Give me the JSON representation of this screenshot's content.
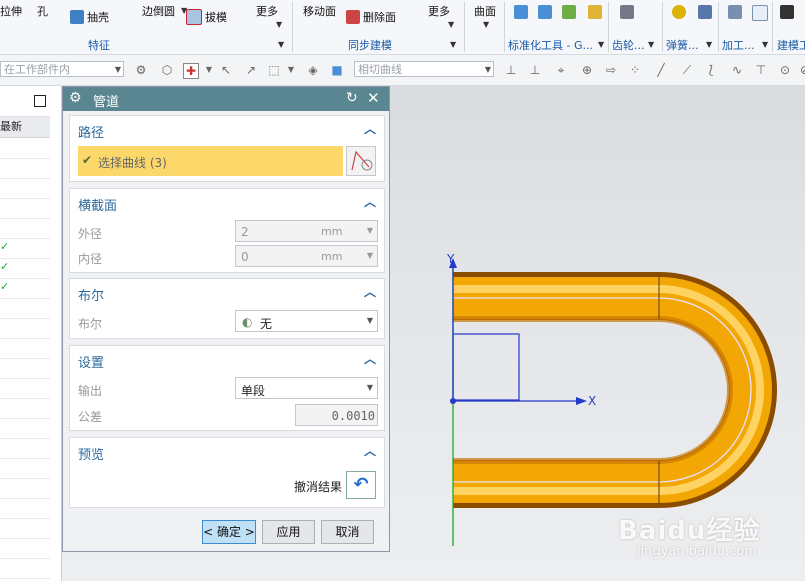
{
  "ribbon": {
    "partial_left_top": "拉伸",
    "hole": "孔",
    "shell": "抽壳",
    "edge_blend": "边倒圆",
    "draft": "拔模",
    "more1": "更多",
    "move_face": "移动面",
    "delete_face": "删除面",
    "more2": "更多",
    "surface": "曲面",
    "group_feature": "特征",
    "group_sync": "同步建模",
    "group_std_tools": "标准化工具 - G...",
    "group_gear": "齿轮...",
    "group_spring": "弹簧...",
    "group_machining": "加工...",
    "group_modeling": "建模工"
  },
  "toolbar2": {
    "scope_combo": "在工作部件内",
    "curve_rule_combo": "相切曲线"
  },
  "left_pane": {
    "partial_header": "最新"
  },
  "dialog": {
    "title": "管道",
    "path": {
      "title": "路径",
      "select_label": "选择曲线 (3)"
    },
    "cross_section": {
      "title": "横截面",
      "outer_label": "外径",
      "outer_value": "2",
      "outer_unit": "mm",
      "inner_label": "内径",
      "inner_value": "0",
      "inner_unit": "mm"
    },
    "boolean": {
      "title": "布尔",
      "label": "布尔",
      "value": "无"
    },
    "settings": {
      "title": "设置",
      "output_label": "输出",
      "output_value": "单段",
      "tolerance_label": "公差",
      "tolerance_value": "0.0010"
    },
    "preview": {
      "title": "预览",
      "undo_label": "撤消结果"
    },
    "buttons": {
      "ok": "< 确定 >",
      "apply": "应用",
      "cancel": "取消"
    }
  },
  "viewport": {
    "axis_y": "Y",
    "axis_x": "X",
    "watermark": "Baidu经验",
    "watermark_url": "jingyan.baidu.com"
  },
  "colors": {
    "pipe": "#f2a705",
    "accent": "#2d6a9c",
    "title_bar": "#5a8691",
    "highlight": "#fcd86a"
  }
}
